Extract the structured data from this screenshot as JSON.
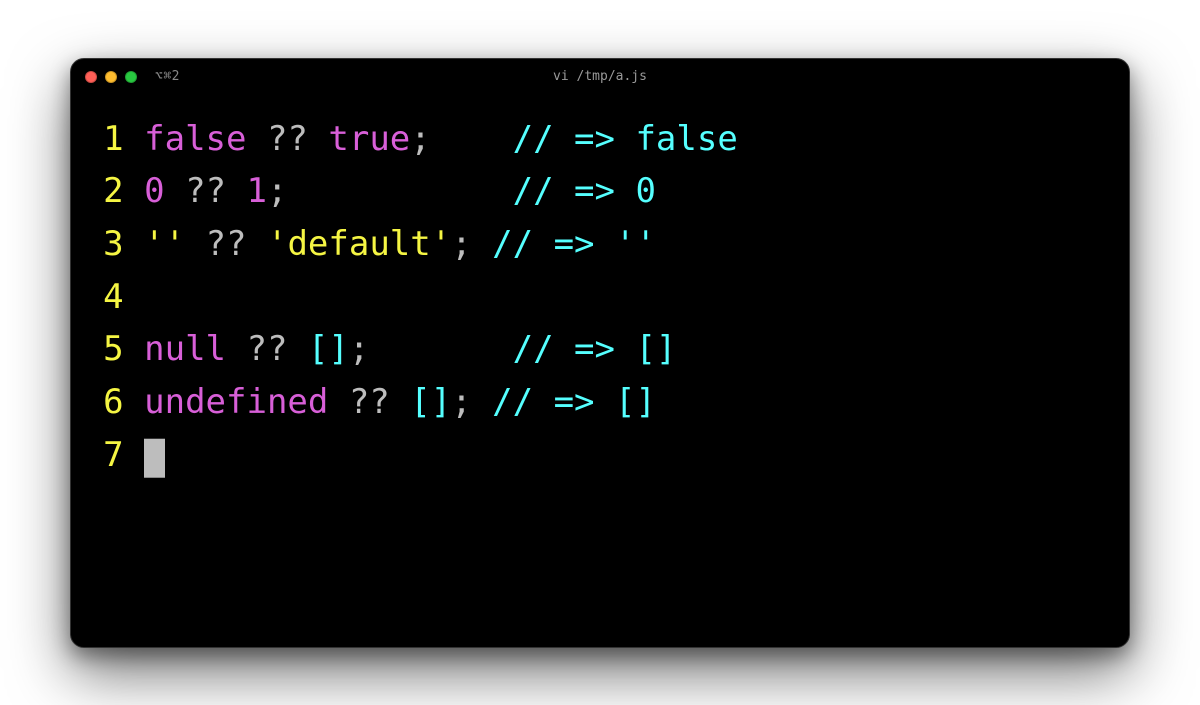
{
  "window": {
    "tab_indicator": "⌥⌘2",
    "title": "vi /tmp/a.js"
  },
  "editor": {
    "lines": [
      {
        "n": "1",
        "tokens": [
          {
            "cls": "tok-kw",
            "t": "false"
          },
          {
            "cls": "tok-op",
            "t": " ?? "
          },
          {
            "cls": "tok-kw",
            "t": "true"
          },
          {
            "cls": "tok-op",
            "t": ";    "
          },
          {
            "cls": "tok-comment",
            "t": "// => false"
          }
        ]
      },
      {
        "n": "2",
        "tokens": [
          {
            "cls": "tok-num",
            "t": "0"
          },
          {
            "cls": "tok-op",
            "t": " ?? "
          },
          {
            "cls": "tok-num",
            "t": "1"
          },
          {
            "cls": "tok-op",
            "t": ";           "
          },
          {
            "cls": "tok-comment",
            "t": "// => 0"
          }
        ]
      },
      {
        "n": "3",
        "tokens": [
          {
            "cls": "tok-str",
            "t": "''"
          },
          {
            "cls": "tok-op",
            "t": " ?? "
          },
          {
            "cls": "tok-str",
            "t": "'default'"
          },
          {
            "cls": "tok-op",
            "t": "; "
          },
          {
            "cls": "tok-comment",
            "t": "// => ''"
          }
        ]
      },
      {
        "n": "4",
        "tokens": []
      },
      {
        "n": "5",
        "tokens": [
          {
            "cls": "tok-kw",
            "t": "null"
          },
          {
            "cls": "tok-op",
            "t": " ?? "
          },
          {
            "cls": "tok-bracket",
            "t": "[]"
          },
          {
            "cls": "tok-op",
            "t": ";       "
          },
          {
            "cls": "tok-comment",
            "t": "// => []"
          }
        ]
      },
      {
        "n": "6",
        "tokens": [
          {
            "cls": "tok-kw",
            "t": "undefined"
          },
          {
            "cls": "tok-op",
            "t": " ?? "
          },
          {
            "cls": "tok-bracket",
            "t": "[]"
          },
          {
            "cls": "tok-op",
            "t": "; "
          },
          {
            "cls": "tok-comment",
            "t": "// => []"
          }
        ]
      },
      {
        "n": "7",
        "cursor": true,
        "tokens": []
      }
    ]
  }
}
